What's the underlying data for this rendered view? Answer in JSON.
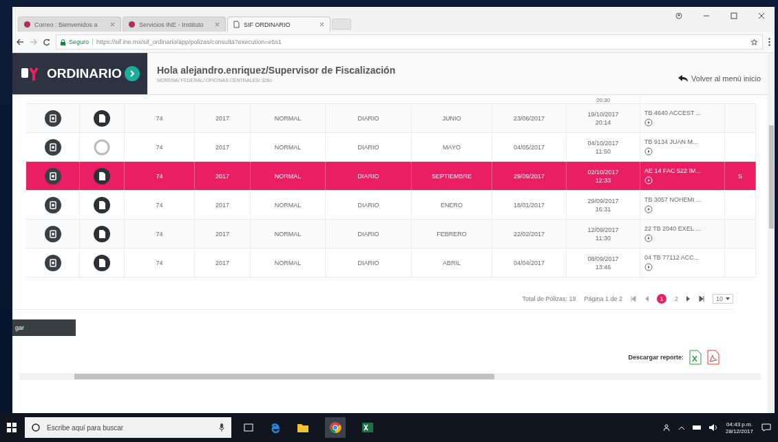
{
  "browser": {
    "tabs": [
      {
        "label": "Correo : Bienvenidos a",
        "selected": false
      },
      {
        "label": "Servicios INE - Instituto",
        "selected": false
      },
      {
        "label": "SIF ORDINARIO",
        "selected": true
      }
    ],
    "secure_label": "Seguro",
    "url": "https://sif.ine.mx/sif_ordinario/app/polizas/consulta?execution=e5s1"
  },
  "header": {
    "logo_text": "ORDINARIO",
    "greeting": "Hola alejandro.enriquez/Supervisor de Fiscalización",
    "subtitle": "MORENA/ FEDERAL/ OFICINAS CENTRALES/ 326o",
    "back_link": "Volver al menú inicio"
  },
  "table": {
    "partial_row": {
      "time": "20:30"
    },
    "rows": [
      {
        "selected": false,
        "kind": "document",
        "col_3": "74",
        "col_4": "2017",
        "col_5": "NORMAL",
        "col_6": "DIARIO",
        "col_7": "JUNIO",
        "col_8": "23/06/2017",
        "col_9": [
          "19/10/2017",
          "20:14"
        ],
        "col_10": "TB 4640 ACCEST ..."
      },
      {
        "selected": false,
        "kind": "empty",
        "col_3": "74",
        "col_4": "2017",
        "col_5": "NORMAL",
        "col_6": "DIARIO",
        "col_7": "MAYO",
        "col_8": "04/05/2017",
        "col_9": [
          "04/10/2017",
          "11:50"
        ],
        "col_10": "TB 9134 JUAN M..."
      },
      {
        "selected": true,
        "kind": "document",
        "col_3": "74",
        "col_4": "2017",
        "col_5": "NORMAL",
        "col_6": "DIARIO",
        "col_7": "SEPTIEMBRE",
        "col_8": "29/09/2017",
        "col_9": [
          "02/10/2017",
          "12:33"
        ],
        "col_10": "AE 14 FAC 522 IM...",
        "col_11": "S"
      },
      {
        "selected": false,
        "kind": "document",
        "col_3": "74",
        "col_4": "2017",
        "col_5": "NORMAL",
        "col_6": "DIARIO",
        "col_7": "ENERO",
        "col_8": "18/01/2017",
        "col_9": [
          "29/09/2017",
          "16:31"
        ],
        "col_10": "TB 3057 NOHEMI ..."
      },
      {
        "selected": false,
        "kind": "document",
        "col_3": "74",
        "col_4": "2017",
        "col_5": "NORMAL",
        "col_6": "DIARIO",
        "col_7": "FEBRERO",
        "col_8": "22/02/2017",
        "col_9": [
          "12/09/2017",
          "11:30"
        ],
        "col_10": "22 TB 2040 EXEL ..."
      },
      {
        "selected": false,
        "kind": "document",
        "col_3": "74",
        "col_4": "2017",
        "col_5": "NORMAL",
        "col_6": "DIARIO",
        "col_7": "ABRIL",
        "col_8": "04/04/2017",
        "col_9": [
          "08/09/2017",
          "13:46"
        ],
        "col_10": "04 TB 77112 ACC..."
      }
    ]
  },
  "pagination": {
    "total": "Total de Pólizas: 19",
    "page_info": "Página 1 de 2",
    "pages": [
      {
        "label": "1",
        "selected": true
      },
      {
        "label": "2",
        "selected": false
      }
    ],
    "page_size": "10"
  },
  "cut_button": "gar",
  "download_label": "Descargar reporte:",
  "taskbar": {
    "search_placeholder": "Escribe aquí para buscar",
    "time": "04:43 p.m.",
    "date": "28/12/2017"
  }
}
